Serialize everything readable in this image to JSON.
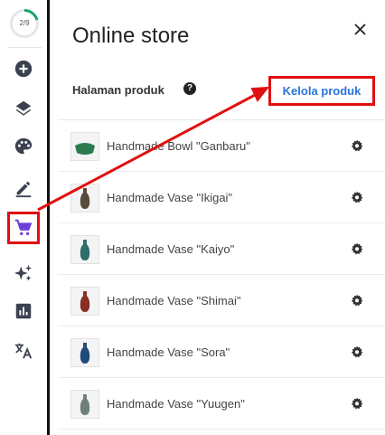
{
  "rail": {
    "progress_text": "2/9",
    "progress_fraction": 0.22,
    "items": [
      {
        "icon": "add-circle-icon"
      },
      {
        "icon": "layers-icon"
      },
      {
        "icon": "palette-icon"
      },
      {
        "icon": "edit-icon"
      },
      {
        "icon": "cart-icon",
        "active": true
      },
      {
        "icon": "sparkle-icon"
      },
      {
        "icon": "chart-icon"
      },
      {
        "icon": "translate-icon"
      }
    ]
  },
  "panel": {
    "title": "Online store",
    "close_label": "×",
    "section_label": "Halaman produk",
    "help_label": "?",
    "manage_label": "Kelola produk"
  },
  "products": [
    {
      "name": "Handmade Bowl \"Ganbaru\"",
      "thumb_color": "#2d7a4e"
    },
    {
      "name": "Handmade Vase \"Ikigai\"",
      "thumb_color": "#5a4a3a"
    },
    {
      "name": "Handmade Vase \"Kaiyo\"",
      "thumb_color": "#2f6f6b"
    },
    {
      "name": "Handmade Vase \"Shimai\"",
      "thumb_color": "#8a2e28"
    },
    {
      "name": "Handmade Vase \"Sora\"",
      "thumb_color": "#1f4c7a"
    },
    {
      "name": "Handmade Vase \"Yuugen\"",
      "thumb_color": "#6f7f7a"
    }
  ],
  "colors": {
    "accent": "#2b74d9",
    "highlight": "#e01010",
    "cart_active": "#6a3fd8"
  }
}
